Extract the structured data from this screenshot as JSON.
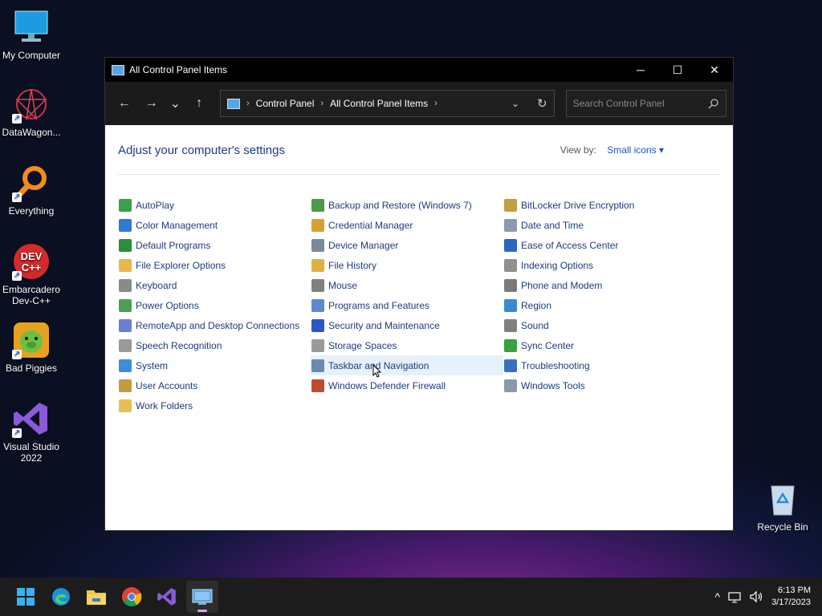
{
  "desktop": {
    "icons": [
      {
        "label": "My Computer"
      },
      {
        "label": "DataWagon..."
      },
      {
        "label": "Everything"
      },
      {
        "label": "Embarcadero Dev-C++"
      },
      {
        "label": "Bad Piggies"
      },
      {
        "label": "Visual Studio 2022"
      },
      {
        "label": "Recycle Bin"
      }
    ]
  },
  "window": {
    "title": "All Control Panel Items",
    "controls": {
      "minimize": "─",
      "maximize": "☐",
      "close": "✕"
    },
    "nav": {
      "back": "←",
      "forward": "→",
      "recent": "⌄",
      "up": "↑"
    },
    "address": {
      "crumbs": [
        "Control Panel",
        "All Control Panel Items"
      ],
      "separator": "›",
      "dropdown": "⌄",
      "refresh": "↻"
    },
    "search": {
      "placeholder": "Search Control Panel",
      "value": ""
    },
    "heading": "Adjust your computer's settings",
    "view_by": {
      "label": "View by:",
      "value": "Small icons ▾"
    },
    "columns": [
      [
        {
          "label": "AutoPlay",
          "color": "#3aa04a"
        },
        {
          "label": "Color Management",
          "color": "#2f7bd3"
        },
        {
          "label": "Default Programs",
          "color": "#2b8f3a"
        },
        {
          "label": "File Explorer Options",
          "color": "#e8b84a"
        },
        {
          "label": "Keyboard",
          "color": "#8a8a8a"
        },
        {
          "label": "Power Options",
          "color": "#4aa050"
        },
        {
          "label": "RemoteApp and Desktop Connections",
          "color": "#6a7fd0"
        },
        {
          "label": "Speech Recognition",
          "color": "#9a9a9a"
        },
        {
          "label": "System",
          "color": "#3a90d8"
        },
        {
          "label": "User Accounts",
          "color": "#c89a40"
        },
        {
          "label": "Work Folders",
          "color": "#e8c050"
        }
      ],
      [
        {
          "label": "Backup and Restore (Windows 7)",
          "color": "#4a9a48"
        },
        {
          "label": "Credential Manager",
          "color": "#d8a030"
        },
        {
          "label": "Device Manager",
          "color": "#7a8a9a"
        },
        {
          "label": "File History",
          "color": "#e0b040"
        },
        {
          "label": "Mouse",
          "color": "#808080"
        },
        {
          "label": "Programs and Features",
          "color": "#5a8ad0"
        },
        {
          "label": "Security and Maintenance",
          "color": "#2a58c8"
        },
        {
          "label": "Storage Spaces",
          "color": "#9a9a9a"
        },
        {
          "label": "Taskbar and Navigation",
          "color": "#6a8ab0"
        },
        {
          "label": "Windows Defender Firewall",
          "color": "#c04a30"
        }
      ],
      [
        {
          "label": "BitLocker Drive Encryption",
          "color": "#c0a040"
        },
        {
          "label": "Date and Time",
          "color": "#8a9ab0"
        },
        {
          "label": "Ease of Access Center",
          "color": "#2a68c0"
        },
        {
          "label": "Indexing Options",
          "color": "#909090"
        },
        {
          "label": "Phone and Modem",
          "color": "#7a7a7a"
        },
        {
          "label": "Region",
          "color": "#3a8ad0"
        },
        {
          "label": "Sound",
          "color": "#808080"
        },
        {
          "label": "Sync Center",
          "color": "#3aa040"
        },
        {
          "label": "Troubleshooting",
          "color": "#3a70c0"
        },
        {
          "label": "Windows Tools",
          "color": "#8a9aa8"
        }
      ]
    ]
  },
  "taskbar": {
    "apps": [
      "start",
      "edge",
      "file-explorer",
      "chrome",
      "visual-studio",
      "control-panel"
    ],
    "tray": {
      "chevron": "^",
      "time": "6:13 PM",
      "date": "3/17/2023"
    }
  }
}
